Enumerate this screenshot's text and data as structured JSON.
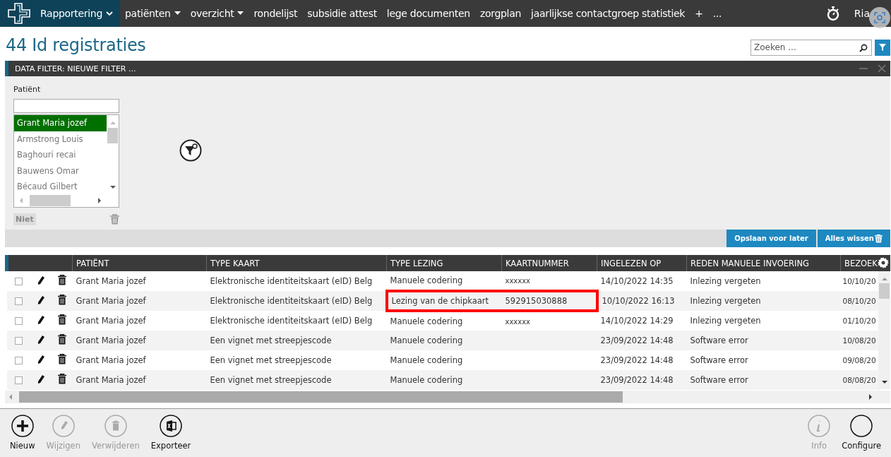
{
  "nav": {
    "items": [
      {
        "label": "Rapportering",
        "selected": true,
        "kind": "chevron"
      },
      {
        "label": "patiënten",
        "selected": false,
        "kind": "caret"
      },
      {
        "label": "overzicht",
        "selected": false,
        "kind": "caret"
      },
      {
        "label": "rondelijst",
        "selected": false,
        "kind": "plain"
      },
      {
        "label": "subsidie attest",
        "selected": false,
        "kind": "plain"
      },
      {
        "label": "lege documenten",
        "selected": false,
        "kind": "plain"
      },
      {
        "label": "zorgplan",
        "selected": false,
        "kind": "plain"
      },
      {
        "label": "jaarlijkse contactgroep statistiek",
        "selected": false,
        "kind": "plain"
      },
      {
        "label": "+",
        "selected": false,
        "kind": "plain"
      },
      {
        "label": "...",
        "selected": false,
        "kind": "plain"
      }
    ],
    "user": "Ria"
  },
  "page_title": "44 Id registraties",
  "search": {
    "placeholder": "Zoeken ..."
  },
  "filter_panel": {
    "title": "DATA FILTER: NIEUWE FILTER ...",
    "field_label": "Patiënt",
    "patients": [
      {
        "name": "Grant Maria jozef",
        "selected": true
      },
      {
        "name": "Armstrong Louis",
        "selected": false
      },
      {
        "name": "Baghouri recai",
        "selected": false
      },
      {
        "name": "Bauwens Omar",
        "selected": false
      },
      {
        "name": "Bécaud Gilbert",
        "selected": false
      }
    ],
    "negate_button": "Niet",
    "buttons": [
      "Opslaan voor later",
      "Alles wissen"
    ]
  },
  "table": {
    "columns": [
      "PATIËNT",
      "TYPE KAART",
      "TYPE LEZING",
      "KAARTNUMMER",
      "INGELEZEN OP",
      "REDEN MANUELE INVOERING",
      "BEZOEK"
    ],
    "rows": [
      {
        "checked": false,
        "highlighted": false,
        "cells": [
          "Grant Maria jozef",
          "Elektronische identiteitskaart (eID) Belg",
          "Manuele codering",
          "xxxxxx",
          "14/10/2022 14:35",
          "Inlezing vergeten",
          "10/10/20"
        ]
      },
      {
        "checked": false,
        "highlighted": true,
        "cells": [
          "Grant Maria jozef",
          "Elektronische identiteitskaart (eID) Belg",
          "Lezing van de chipkaart",
          "592915030888",
          "10/10/2022 16:13",
          "Inlezing vergeten",
          "08/10/20"
        ]
      },
      {
        "checked": false,
        "highlighted": false,
        "cells": [
          "Grant Maria jozef",
          "Elektronische identiteitskaart (eID) Belg",
          "Manuele codering",
          "xxxxxx",
          "14/10/2022 14:29",
          "Inlezing vergeten",
          "01/10/20"
        ]
      },
      {
        "checked": false,
        "highlighted": false,
        "cells": [
          "Grant Maria jozef",
          "Een vignet met streepjescode",
          "Manuele codering",
          "",
          "23/09/2022 14:48",
          "Software error",
          "10/08/20"
        ]
      },
      {
        "checked": false,
        "highlighted": false,
        "cells": [
          "Grant Maria jozef",
          "Een vignet met streepjescode",
          "Manuele codering",
          "",
          "23/09/2022 14:48",
          "Software error",
          "09/08/20"
        ]
      },
      {
        "checked": false,
        "highlighted": false,
        "cells": [
          "Grant Maria jozef",
          "Een vignet met streepjescode",
          "Manuele codering",
          "",
          "23/09/2022 14:48",
          "Software error",
          "08/08/20"
        ]
      }
    ]
  },
  "toolbar": {
    "left": [
      {
        "kind": "new",
        "label": "Nieuw",
        "disabled": false
      },
      {
        "kind": "edit",
        "label": "Wijzigen",
        "disabled": true
      },
      {
        "kind": "delete",
        "label": "Verwijderen",
        "disabled": true
      },
      {
        "kind": "export",
        "label": "Exporteer",
        "disabled": false
      }
    ],
    "right": [
      {
        "kind": "info",
        "label": "Info",
        "disabled": true
      },
      {
        "kind": "blank",
        "label": "Configure",
        "disabled": false
      }
    ]
  }
}
